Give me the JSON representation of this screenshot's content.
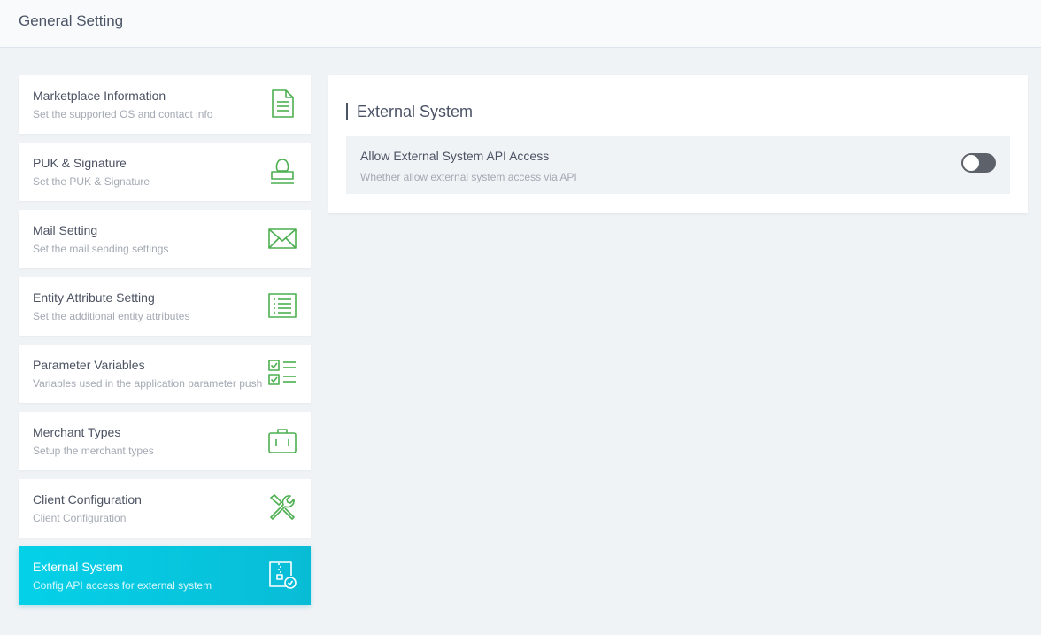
{
  "header": {
    "title": "General Setting"
  },
  "colors": {
    "accent": "#09bcd6",
    "icon_green": "#4caf50",
    "toggle_off": "#5d6169"
  },
  "sidebar": {
    "items": [
      {
        "title": "Marketplace Information",
        "desc": "Set the supported OS and contact info",
        "icon": "document-icon"
      },
      {
        "title": "PUK & Signature",
        "desc": "Set the PUK & Signature",
        "icon": "stamp-icon"
      },
      {
        "title": "Mail Setting",
        "desc": "Set the mail sending settings",
        "icon": "envelope-icon"
      },
      {
        "title": "Entity Attribute Setting",
        "desc": "Set the additional entity attributes",
        "icon": "list-icon"
      },
      {
        "title": "Parameter Variables",
        "desc": "Variables used in the application parameter push",
        "icon": "checklist-icon"
      },
      {
        "title": "Merchant Types",
        "desc": "Setup the merchant types",
        "icon": "briefcase-icon"
      },
      {
        "title": "Client Configuration",
        "desc": "Client Configuration",
        "icon": "tools-icon"
      },
      {
        "title": "External System",
        "desc": "Config API access for external system",
        "icon": "external-system-icon",
        "active": true
      }
    ]
  },
  "panel": {
    "title": "External System",
    "setting": {
      "title": "Allow External System API Access",
      "desc": "Whether allow external system access via API",
      "enabled": false
    }
  }
}
